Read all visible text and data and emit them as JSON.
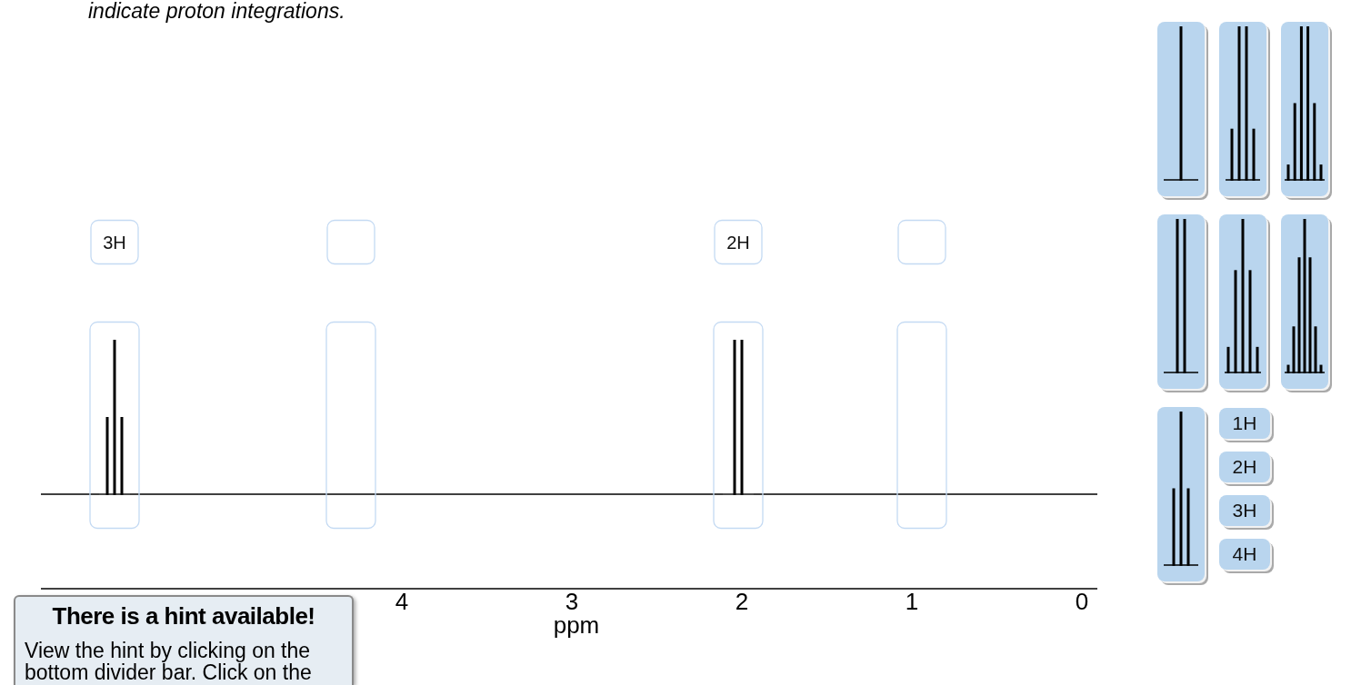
{
  "instructions": {
    "text": "indicate proton integrations."
  },
  "spectrum": {
    "axis_title": "ppm",
    "tick_labels": [
      "4",
      "3",
      "2",
      "1",
      "0"
    ],
    "drop_zones": [
      {
        "integration": "3H",
        "kind": "triplet"
      },
      {
        "kind": "empty"
      },
      {
        "integration": "2H",
        "kind": "doublet"
      },
      {
        "kind": "empty"
      }
    ]
  },
  "palette": {
    "multiplets": [
      {
        "kind": "singlet"
      },
      {
        "kind": "quartet"
      },
      {
        "kind": "sextet"
      },
      {
        "kind": "doublet"
      },
      {
        "kind": "pentet"
      },
      {
        "kind": "septet"
      },
      {
        "kind": "triplet"
      }
    ],
    "integrations": [
      "1H",
      "2H",
      "3H",
      "4H"
    ]
  },
  "hint": {
    "title": "There is a hint available!",
    "body": "View the hint by clicking on the bottom divider bar. Click on the"
  }
}
